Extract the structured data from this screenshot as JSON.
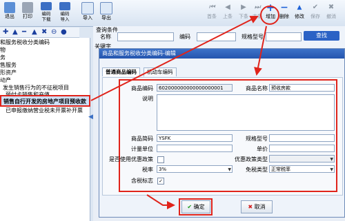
{
  "toolbar": {
    "exit": "退出",
    "print": "打印",
    "code_download": "编码\n下载",
    "code_import": "编码\n导入",
    "import": "导入",
    "export": "导出",
    "first": "首条",
    "prev": "上条",
    "next": "下条",
    "last": "末条",
    "add": "增加",
    "delete": "删除",
    "modify": "修改",
    "save": "保存",
    "cancel": "撤消"
  },
  "tree": {
    "items": [
      "和服务税收分类编码",
      "物",
      "务",
      "售服务",
      "形资产",
      "动产",
      "发生销售行为的不征税项目",
      "预付卡销售和充值",
      "销售自行开发的房地产项目预收款",
      "已申报缴纳营业税未开票补开票"
    ]
  },
  "query": {
    "title": "查询条件",
    "name_label": "名称",
    "code_label": "编码",
    "keyword_label": "关键字",
    "spec_label": "规格型号",
    "search_button": "查找"
  },
  "dialog": {
    "title": "商品和服务税收分类编码-编辑",
    "tabs": [
      "普通商品编码",
      "机动车编码"
    ],
    "fields": {
      "product_code_label": "商品编码",
      "product_code_value": "602000000000000000001",
      "product_name_label": "商品名称",
      "product_name_value": "预收房款",
      "desc_label": "说明",
      "short_code_label": "商品简码",
      "short_code_value": "YSFK",
      "spec_label": "规格型号",
      "unit_label": "计量单位",
      "price_label": "单价",
      "preferential_label": "是否使用优惠政策",
      "preferential_type_label": "优惠政策类型",
      "tax_rate_label": "税率",
      "tax_rate_value": "3%",
      "exempt_type_label": "免税类型",
      "exempt_type_value": "正常税率",
      "tax_included_label": "含税标志"
    },
    "ok_button": "确定",
    "cancel_button": "取消"
  },
  "colors": {
    "highlight_red": "#e0231a",
    "title_blue": "#2455ae"
  }
}
